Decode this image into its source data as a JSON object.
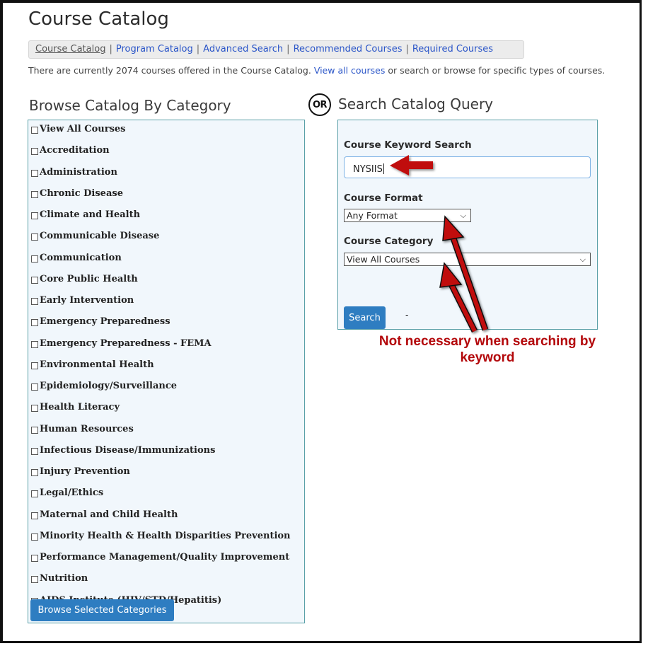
{
  "page": {
    "title": "Course Catalog",
    "nav": [
      {
        "label": "Course Catalog",
        "current": true
      },
      {
        "label": "Program Catalog",
        "current": false
      },
      {
        "label": "Advanced Search",
        "current": false
      },
      {
        "label": "Recommended Courses",
        "current": false
      },
      {
        "label": "Required Courses",
        "current": false
      }
    ],
    "separator": "|",
    "info_prefix": "There are currently 2074 courses offered in the Course Catalog.",
    "info_link": "View all courses",
    "info_suffix": "or search or browse for specific types of courses."
  },
  "browse": {
    "heading": "Browse Catalog By Category",
    "categories": [
      "View All Courses",
      "Accreditation",
      "Administration",
      "Chronic Disease",
      "Climate and Health",
      "Communicable Disease",
      "Communication",
      "Core Public Health",
      "Early Intervention",
      "Emergency Preparedness",
      "Emergency Preparedness - FEMA",
      "Environmental Health",
      "Epidemiology/Surveillance",
      "Health Literacy",
      "Human Resources",
      "Infectious Disease/Immunizations",
      "Injury Prevention",
      "Legal/Ethics",
      "Maternal and Child Health",
      "Minority Health & Health Disparities Prevention",
      "Performance Management/Quality Improvement",
      "Nutrition",
      "AIDS Institute (HIV/STD/Hepatitis)"
    ],
    "button": "Browse Selected Categories"
  },
  "or_label": "OR",
  "search": {
    "heading": "Search Catalog Query",
    "keyword_label": "Course Keyword Search",
    "keyword_value": "NYSIIS",
    "format_label": "Course Format",
    "format_value": "Any Format",
    "category_label": "Course Category",
    "category_value": "View All Courses",
    "button": "Search",
    "dot": "-"
  },
  "annotation": {
    "note": "Not necessary when searching by keyword",
    "color": "#b3070a"
  }
}
